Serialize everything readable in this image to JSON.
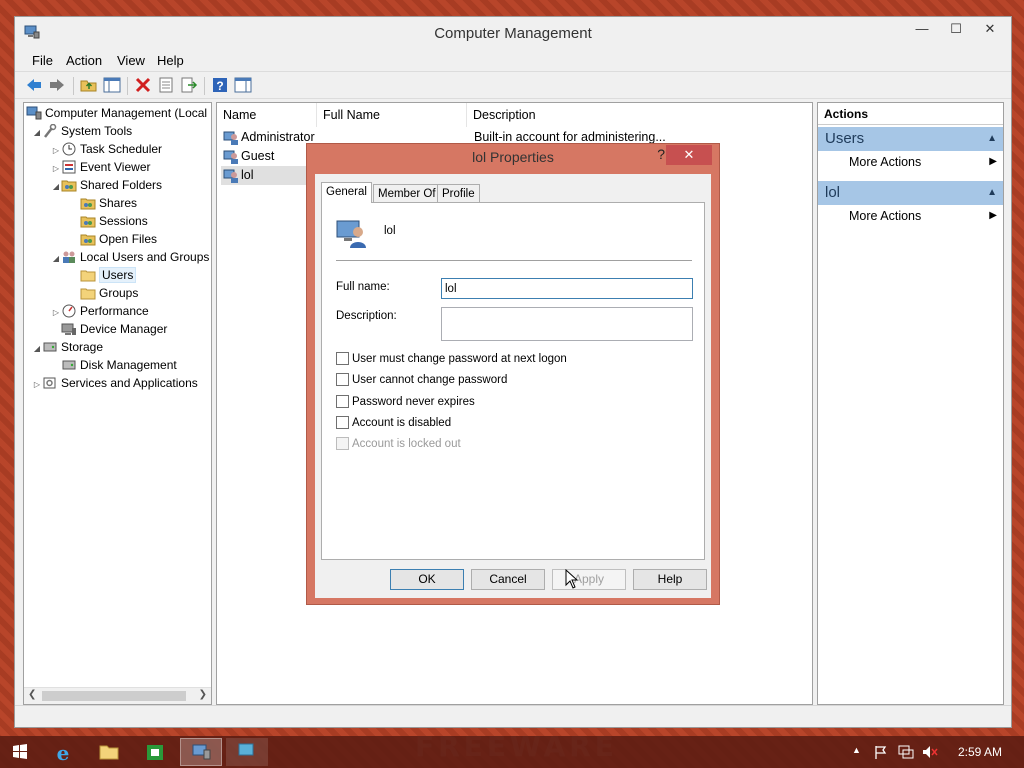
{
  "window": {
    "title": "Computer Management",
    "minimize": "—",
    "maximize": "☐",
    "close": "✕"
  },
  "menu": [
    "File",
    "Action",
    "View",
    "Help"
  ],
  "tree": [
    {
      "label": "Computer Management (Local",
      "icon": "computer-management-icon"
    },
    {
      "label": "System Tools",
      "icon": "tools-icon"
    },
    {
      "label": "Task Scheduler",
      "icon": "clock-icon"
    },
    {
      "label": "Event Viewer",
      "icon": "event-viewer-icon"
    },
    {
      "label": "Shared Folders",
      "icon": "shared-folder-icon"
    },
    {
      "label": "Shares",
      "icon": "shared-folder-icon"
    },
    {
      "label": "Sessions",
      "icon": "shared-folder-icon"
    },
    {
      "label": "Open Files",
      "icon": "shared-folder-icon"
    },
    {
      "label": "Local Users and Groups",
      "icon": "users-icon"
    },
    {
      "label": "Users",
      "icon": "folder-icon"
    },
    {
      "label": "Groups",
      "icon": "folder-icon"
    },
    {
      "label": "Performance",
      "icon": "performance-icon"
    },
    {
      "label": "Device Manager",
      "icon": "device-manager-icon"
    },
    {
      "label": "Storage",
      "icon": "storage-icon"
    },
    {
      "label": "Disk Management",
      "icon": "disk-icon"
    },
    {
      "label": "Services and Applications",
      "icon": "services-icon"
    }
  ],
  "list": {
    "columns": [
      "Name",
      "Full Name",
      "Description"
    ],
    "rows": [
      {
        "name": "Administrator",
        "full_name": "",
        "description": "Built-in account for administering..."
      },
      {
        "name": "Guest",
        "full_name": "",
        "description": ""
      },
      {
        "name": "lol",
        "full_name": "",
        "description": ""
      }
    ]
  },
  "actions": {
    "header": "Actions",
    "groups": [
      {
        "title": "Users",
        "item": "More Actions"
      },
      {
        "title": "lol",
        "item": "More Actions"
      }
    ]
  },
  "dialog": {
    "title": "lol Properties",
    "help": "?",
    "close": "✕",
    "tabs": [
      "General",
      "Member Of",
      "Profile"
    ],
    "user_name": "lol",
    "full_name_label": "Full name:",
    "full_name_value": "lol",
    "description_label": "Description:",
    "description_value": "",
    "checkboxes": [
      {
        "label": "User must change password at next logon",
        "checked": false,
        "disabled": false
      },
      {
        "label": "User cannot change password",
        "checked": false,
        "disabled": false
      },
      {
        "label": "Password never expires",
        "checked": false,
        "disabled": false
      },
      {
        "label": "Account is disabled",
        "checked": false,
        "disabled": false
      },
      {
        "label": "Account is locked out",
        "checked": false,
        "disabled": true
      }
    ],
    "buttons": {
      "ok": "OK",
      "cancel": "Cancel",
      "apply": "Apply",
      "help": "Help"
    }
  },
  "taskbar": {
    "clock": "2:59 AM"
  },
  "watermark": "FREEWARE"
}
